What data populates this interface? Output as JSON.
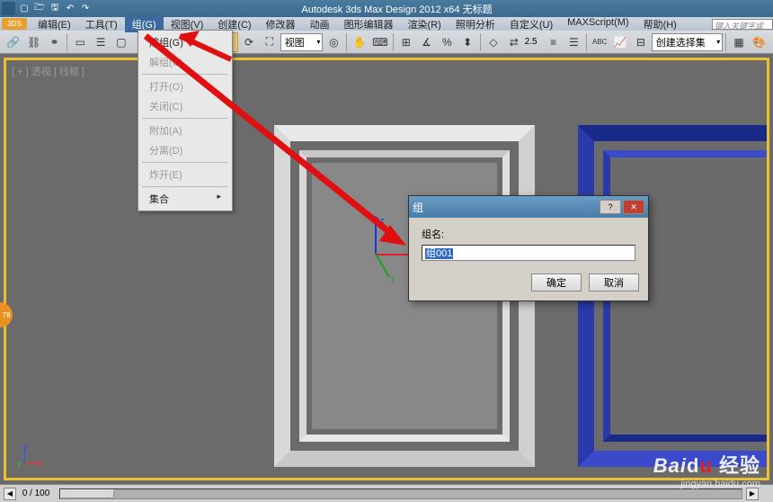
{
  "title": "Autodesk 3ds Max Design 2012 x64     无标题",
  "search_placeholder": "键入关键字或短",
  "menu": [
    "编辑(E)",
    "工具(T)",
    "组(G)",
    "视图(V)",
    "创建(C)",
    "修改器",
    "动画",
    "图形编辑器",
    "渲染(R)",
    "照明分析",
    "自定义(U)",
    "MAXScript(M)",
    "帮助(H)"
  ],
  "active_menu_index": 2,
  "toolbar": {
    "view_dropdown": "视图",
    "spinner": "2.5",
    "selset_dropdown": "创建选择集"
  },
  "viewport_label": "[ + ] 透视 ] 线框 ]",
  "group_menu": [
    {
      "label": "成组(G)",
      "enabled": true
    },
    {
      "label": "解组(U)",
      "enabled": false
    },
    {
      "sep": true
    },
    {
      "label": "打开(O)",
      "enabled": false
    },
    {
      "label": "关闭(C)",
      "enabled": false
    },
    {
      "sep": true
    },
    {
      "label": "附加(A)",
      "enabled": false
    },
    {
      "label": "分离(D)",
      "enabled": false
    },
    {
      "sep": true
    },
    {
      "label": "炸开(E)",
      "enabled": false
    },
    {
      "sep": true
    },
    {
      "label": "集合",
      "enabled": true,
      "arrow": true
    }
  ],
  "dialog": {
    "title": "组",
    "label": "组名:",
    "value": "组001",
    "ok": "确定",
    "cancel": "取消"
  },
  "timeline": "0 / 100",
  "orange_tab": "78",
  "gizmo": {
    "x": "x",
    "y": "y",
    "z": "z"
  },
  "watermark": {
    "brand": "Baidu 经验",
    "url": "jingyan.baidu.com"
  }
}
